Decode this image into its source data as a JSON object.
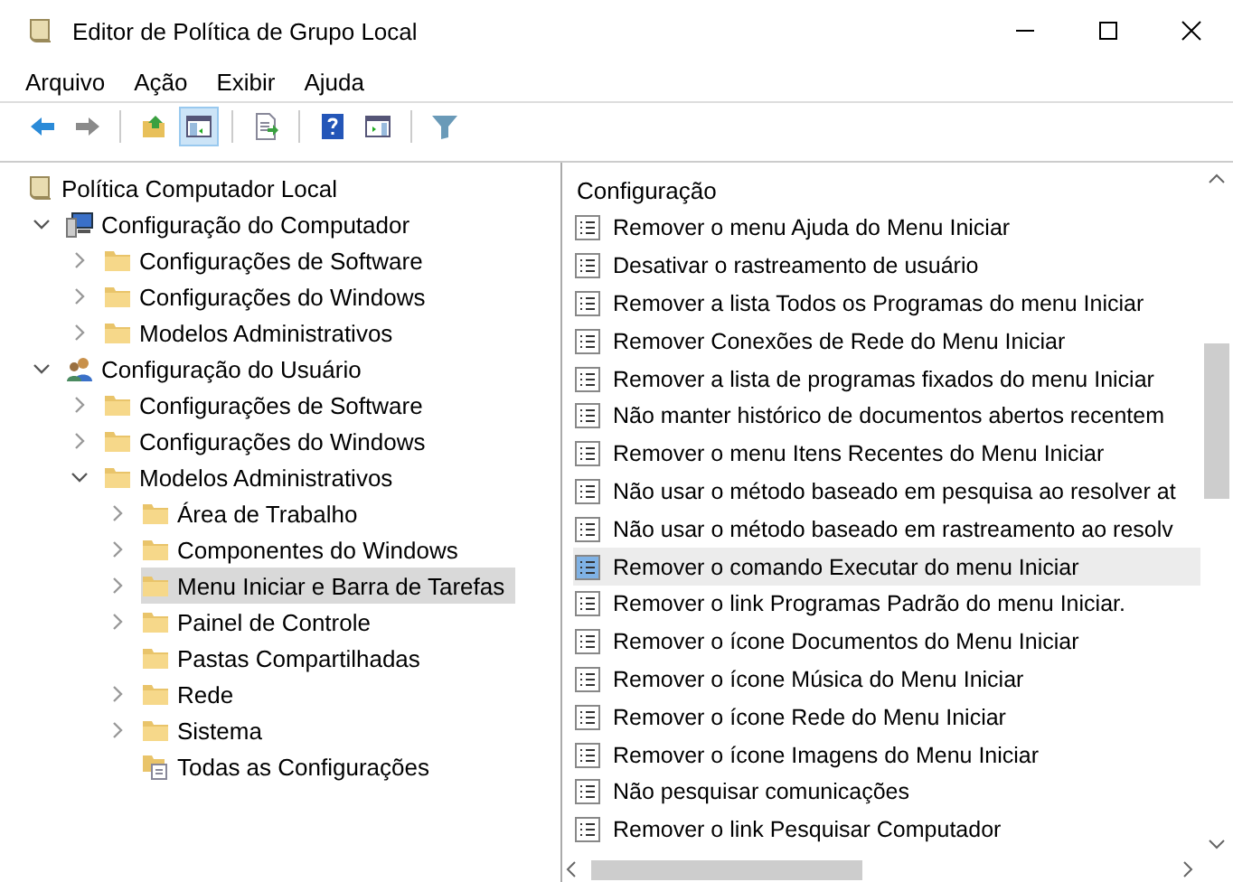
{
  "window": {
    "title": "Editor de Política de Grupo Local"
  },
  "menu": [
    "Arquivo",
    "Ação",
    "Exibir",
    "Ajuda"
  ],
  "toolbar": [
    {
      "kind": "back",
      "pressed": false
    },
    {
      "kind": "forward",
      "pressed": false
    },
    {
      "kind": "sep"
    },
    {
      "kind": "up",
      "pressed": false
    },
    {
      "kind": "tree",
      "pressed": true
    },
    {
      "kind": "sep"
    },
    {
      "kind": "export",
      "pressed": false
    },
    {
      "kind": "sep"
    },
    {
      "kind": "help",
      "pressed": false
    },
    {
      "kind": "pane",
      "pressed": false
    },
    {
      "kind": "sep"
    },
    {
      "kind": "filter",
      "pressed": false
    }
  ],
  "tree": [
    {
      "label": "Política Computador Local",
      "kind": "policy",
      "selected": false,
      "children": [
        {
          "label": "Configuração do Computador",
          "kind": "computer",
          "has_arrow": true,
          "expanded": true,
          "selected": false,
          "children": [
            {
              "label": "Configurações de Software",
              "kind": "folder",
              "has_arrow": true,
              "expanded": false,
              "selected": false
            },
            {
              "label": "Configurações do Windows",
              "kind": "folder",
              "has_arrow": true,
              "expanded": false,
              "selected": false
            },
            {
              "label": "Modelos Administrativos",
              "kind": "folder",
              "has_arrow": true,
              "expanded": false,
              "selected": false
            }
          ]
        },
        {
          "label": "Configuração do Usuário",
          "kind": "user",
          "has_arrow": true,
          "expanded": true,
          "selected": false,
          "children": [
            {
              "label": "Configurações de Software",
              "kind": "folder",
              "has_arrow": true,
              "expanded": false,
              "selected": false
            },
            {
              "label": "Configurações do Windows",
              "kind": "folder",
              "has_arrow": true,
              "expanded": false,
              "selected": false
            },
            {
              "label": "Modelos Administrativos",
              "kind": "folder",
              "has_arrow": true,
              "expanded": true,
              "selected": false,
              "children": [
                {
                  "label": "Área de Trabalho",
                  "kind": "folder",
                  "has_arrow": true,
                  "expanded": false,
                  "selected": false
                },
                {
                  "label": "Componentes do Windows",
                  "kind": "folder",
                  "has_arrow": true,
                  "expanded": false,
                  "selected": false
                },
                {
                  "label": "Menu Iniciar e Barra de Tarefas",
                  "kind": "folder",
                  "has_arrow": true,
                  "expanded": false,
                  "selected": true
                },
                {
                  "label": "Painel de Controle",
                  "kind": "folder",
                  "has_arrow": true,
                  "expanded": false,
                  "selected": false
                },
                {
                  "label": "Pastas Compartilhadas",
                  "kind": "folder",
                  "has_arrow": false,
                  "selected": false
                },
                {
                  "label": "Rede",
                  "kind": "folder",
                  "has_arrow": true,
                  "expanded": false,
                  "selected": false
                },
                {
                  "label": "Sistema",
                  "kind": "folder",
                  "has_arrow": true,
                  "expanded": false,
                  "selected": false
                },
                {
                  "label": "Todas as Configurações",
                  "kind": "all",
                  "has_arrow": false,
                  "selected": false
                }
              ]
            }
          ]
        }
      ]
    }
  ],
  "list": {
    "column": "Configuração",
    "rows": [
      {
        "label": "Remover o menu Ajuda do Menu Iniciar",
        "selected": false
      },
      {
        "label": "Desativar o rastreamento de usuário",
        "selected": false
      },
      {
        "label": "Remover a lista Todos os Programas do menu Iniciar",
        "selected": false
      },
      {
        "label": "Remover Conexões de Rede do Menu Iniciar",
        "selected": false
      },
      {
        "label": "Remover a lista de programas fixados do menu Iniciar",
        "selected": false
      },
      {
        "label": "Não manter histórico de documentos abertos recentem",
        "selected": false
      },
      {
        "label": "Remover o menu Itens Recentes do Menu Iniciar",
        "selected": false
      },
      {
        "label": "Não usar o método baseado em pesquisa ao resolver at",
        "selected": false
      },
      {
        "label": "Não usar o método baseado em rastreamento ao resolv",
        "selected": false
      },
      {
        "label": "Remover o comando Executar do menu Iniciar",
        "selected": true
      },
      {
        "label": "Remover o link Programas Padrão do menu Iniciar.",
        "selected": false
      },
      {
        "label": "Remover o ícone Documentos do Menu Iniciar",
        "selected": false
      },
      {
        "label": "Remover o ícone Música do Menu Iniciar",
        "selected": false
      },
      {
        "label": "Remover o ícone Rede do Menu Iniciar",
        "selected": false
      },
      {
        "label": "Remover o ícone Imagens do Menu Iniciar",
        "selected": false
      },
      {
        "label": "Não pesquisar comunicações",
        "selected": false
      },
      {
        "label": "Remover o link Pesquisar Computador",
        "selected": false
      }
    ]
  }
}
